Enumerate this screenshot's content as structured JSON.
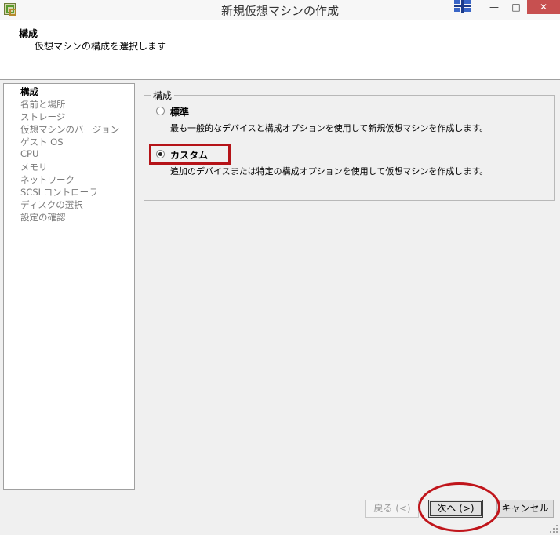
{
  "window": {
    "title": "新規仮想マシンの作成",
    "minimize": "—",
    "maximize": "□",
    "close": "✕"
  },
  "header": {
    "title": "構成",
    "subtitle": "仮想マシンの構成を選択します"
  },
  "sidebar": {
    "items": [
      {
        "label": "構成",
        "active": true
      },
      {
        "label": "名前と場所",
        "active": false
      },
      {
        "label": "ストレージ",
        "active": false
      },
      {
        "label": "仮想マシンのバージョン",
        "active": false
      },
      {
        "label": "ゲスト OS",
        "active": false
      },
      {
        "label": "CPU",
        "active": false
      },
      {
        "label": "メモリ",
        "active": false
      },
      {
        "label": "ネットワーク",
        "active": false
      },
      {
        "label": "SCSI コントローラ",
        "active": false
      },
      {
        "label": "ディスクの選択",
        "active": false
      },
      {
        "label": "設定の確認",
        "active": false
      }
    ]
  },
  "config": {
    "legend": "構成",
    "options": [
      {
        "label": "標準",
        "description": "最も一般的なデバイスと構成オプションを使用して新規仮想マシンを作成します。",
        "selected": false
      },
      {
        "label": "カスタム",
        "description": "追加のデバイスまたは特定の構成オプションを使用して仮想マシンを作成します。",
        "selected": true
      }
    ]
  },
  "footer": {
    "back": "戻る (<)",
    "next": "次へ (>)",
    "cancel": "キャンセル"
  },
  "colors": {
    "annotation": "#c0151b",
    "window_bg": "#f0f0f0"
  }
}
